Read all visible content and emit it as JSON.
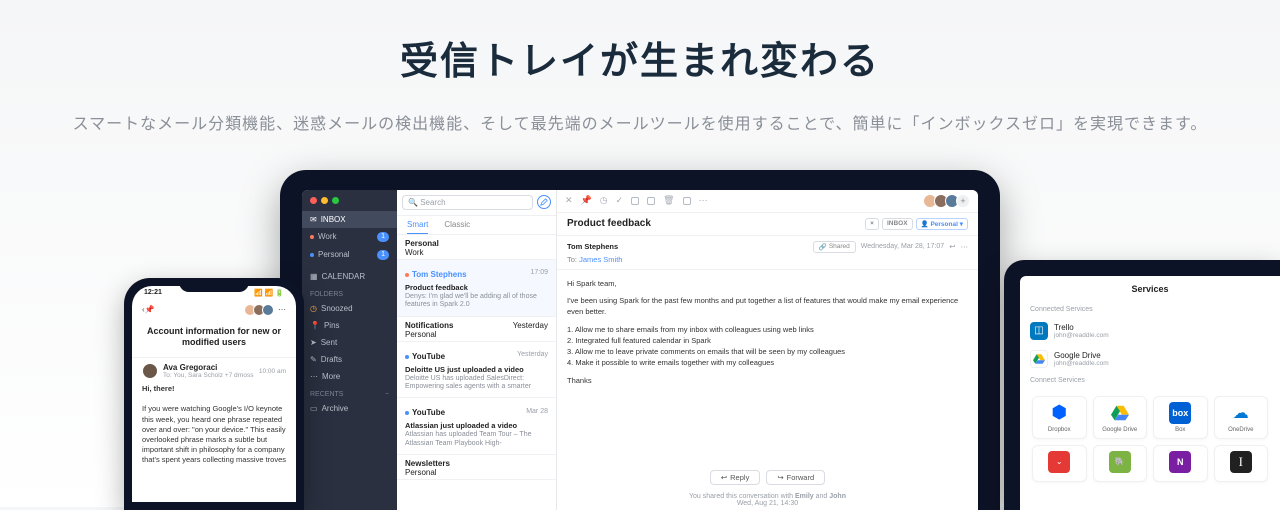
{
  "hero": {
    "title": "受信トレイが生まれ変わる",
    "subtitle": "スマートなメール分類機能、迷惑メールの検出機能、そして最先端のメールツールを使用することで、簡単に「インボックスゼロ」を実現できます。"
  },
  "sidebar": {
    "inbox": "INBOX",
    "work": "Work",
    "work_badge": "1",
    "personal": "Personal",
    "personal_badge": "1",
    "calendar": "CALENDAR",
    "folders": "Folders",
    "snoozed": "Snoozed",
    "pins": "Pins",
    "sent": "Sent",
    "drafts": "Drafts",
    "more": "More",
    "recents": "Recents",
    "archive": "Archive"
  },
  "list": {
    "search_placeholder": "Search",
    "tab_smart": "Smart",
    "tab_classic": "Classic",
    "g_personal": "Personal",
    "g_personal_sub": "Work",
    "m0": {
      "name": "Tom Stephens",
      "subject": "Product feedback",
      "preview": "Denys: I'm glad we'll be adding all of those features in Spark 2.0",
      "time": "17:09"
    },
    "g_notif": "Notifications",
    "g_notif_sub": "Personal",
    "g_notif_time": "Yesterday",
    "m1": {
      "name": "YouTube",
      "subject": "Deloitte US just uploaded a video",
      "preview": "Deloitte US has uploaded SalesDirect: Empowering sales agents with a smarter",
      "time": "Yesterday"
    },
    "m2": {
      "name": "YouTube",
      "subject": "Atlassian just uploaded a video",
      "preview": "Atlassian has uploaded Team Tour – The Atlassian Team Playbook High-",
      "time": "Mar 28"
    },
    "g_news": "Newsletters",
    "g_news_sub": "Personal"
  },
  "detail": {
    "subject": "Product feedback",
    "chip_x": "×",
    "chip_inbox": "INBOX",
    "chip_personal": "Personal",
    "from": "Tom Stephens",
    "to_label": "To:",
    "to_name": "James Smith",
    "shared": "Shared",
    "date": "Wednesday, Mar 28, 17:07",
    "greeting": "Hi Spark team,",
    "p1": "I've been using Spark for the past few months and put together a list of features that would make my email experience even better.",
    "li1": "1. Allow me to share emails from my inbox with colleagues using web links",
    "li2": "2. Integrated full featured calendar in Spark",
    "li3": "3. Allow me to leave private comments on emails that will be seen by my colleagues",
    "li4": "4. Make it possible to write emails together with my colleagues",
    "thanks": "Thanks",
    "reply": "Reply",
    "forward": "Forward",
    "footer_pre": "You shared this conversation with ",
    "footer_e": "Emily",
    "footer_and": " and ",
    "footer_j": "John",
    "footer_date": "Wed, Aug 21, 14:30"
  },
  "phone": {
    "time": "12:21",
    "title": "Account information for new or modified users",
    "sender": "Ava Gregoraci",
    "meta": "To: You, Sara Scholz +7   drnoss",
    "msg_time": "10:00 am",
    "greet": "Hi, there!",
    "body": "If you were watching Google's I/O keynote this week, you heard one phrase repeated over and over: \"on your device.\" This easily overlooked phrase marks a subtle but important shift in philosophy for a company that's spent years collecting massive troves"
  },
  "tablet": {
    "title": "Services",
    "connected": "Connected Services",
    "s1": {
      "name": "Trello",
      "email": "john@readdle.com"
    },
    "s2": {
      "name": "Google Drive",
      "email": "john@readdle.com"
    },
    "connect": "Connect Services",
    "c1": "Dropbox",
    "c2": "Google Drive",
    "c3": "Box",
    "c4": "OneDrive"
  }
}
